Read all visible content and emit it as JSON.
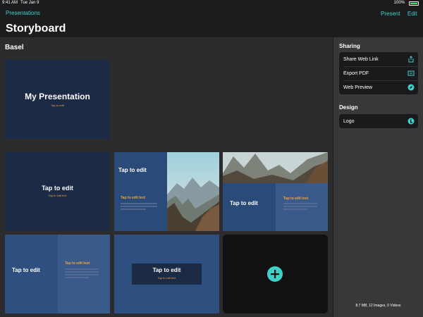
{
  "status": {
    "time": "9:41 AM",
    "date": "Tue Jan 9",
    "battery": "100%"
  },
  "nav": {
    "back_label": "Presentations",
    "present_label": "Present",
    "edit_label": "Edit"
  },
  "page_title": "Storyboard",
  "section_label": "Basel",
  "slides": {
    "title_slide": {
      "title": "My Presentation",
      "subtitle": "Tap to edit"
    },
    "slide2": {
      "title": "Tap to edit",
      "subtitle": "Tap to edit text"
    },
    "slide3": {
      "title": "Tap to edit",
      "subtitle": "Tap to edit text"
    },
    "slide4": {
      "title": "Tap to edit",
      "subtitle": "Tap to edit text"
    },
    "slide5": {
      "title": "Tap to edit",
      "subtitle": "Tap to edit text"
    },
    "slide6": {
      "title": "Tap to edit",
      "subtitle": "Tap to edit text"
    }
  },
  "sidebar": {
    "sharing_heading": "Sharing",
    "sharing_items": [
      {
        "label": "Share Web Link",
        "icon": "share-icon"
      },
      {
        "label": "Export PDF",
        "icon": "pdf-icon"
      },
      {
        "label": "Web Preview",
        "icon": "compass-icon"
      }
    ],
    "design_heading": "Design",
    "design_items": [
      {
        "label": "Logo",
        "icon": "logo-icon"
      }
    ],
    "storage_info": "8.7 MB, 12 Images, 0 Videos"
  },
  "colors": {
    "accent": "#3fd0c9",
    "slide_dark": "#1b2a45",
    "slide_blue": "#2a4a7a",
    "subtitle_orange": "#f0a43a"
  }
}
